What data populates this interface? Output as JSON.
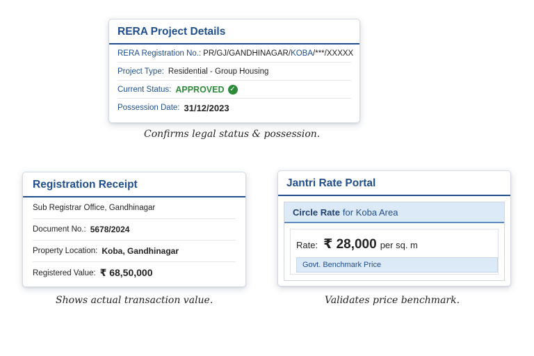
{
  "rera": {
    "title": "RERA Project Details",
    "reg_label": "RERA Registration No.:",
    "reg_part1": "PR/GJ/GANDHINAGAR/",
    "reg_part2": "KOBA",
    "reg_part3": "/***/XXXXX",
    "type_label": "Project Type:",
    "type_value": "Residential - Group Housing",
    "status_label": "Current Status:",
    "status_value": "APPROVED",
    "status_icon": "check-circle-icon",
    "possession_label": "Possession Date:",
    "possession_value": "31/12/2023",
    "caption": "Confirms legal status & possession."
  },
  "registration": {
    "title": "Registration Receipt",
    "office": "Sub Registrar Office, Gandhinagar",
    "doc_label": "Document No.:",
    "doc_value": "5678/2024",
    "location_label": "Property Location:",
    "location_value": "Koba, Gandhinagar",
    "value_label": "Registered Value:",
    "value_amount": "₹ 68,50,000",
    "caption": "Shows actual transaction value."
  },
  "jantri": {
    "title": "Jantri Rate Portal",
    "circle_bold": "Circle Rate",
    "circle_rest": "for Koba Area",
    "rate_label": "Rate:",
    "rate_value": "₹ 28,000",
    "rate_unit": "per sq. m",
    "benchmark": "Govt. Benchmark Price",
    "caption": "Validates price benchmark."
  },
  "colors": {
    "accent": "#1f4e8c",
    "approved": "#2e8b3a",
    "highlight": "#dce9f6"
  }
}
